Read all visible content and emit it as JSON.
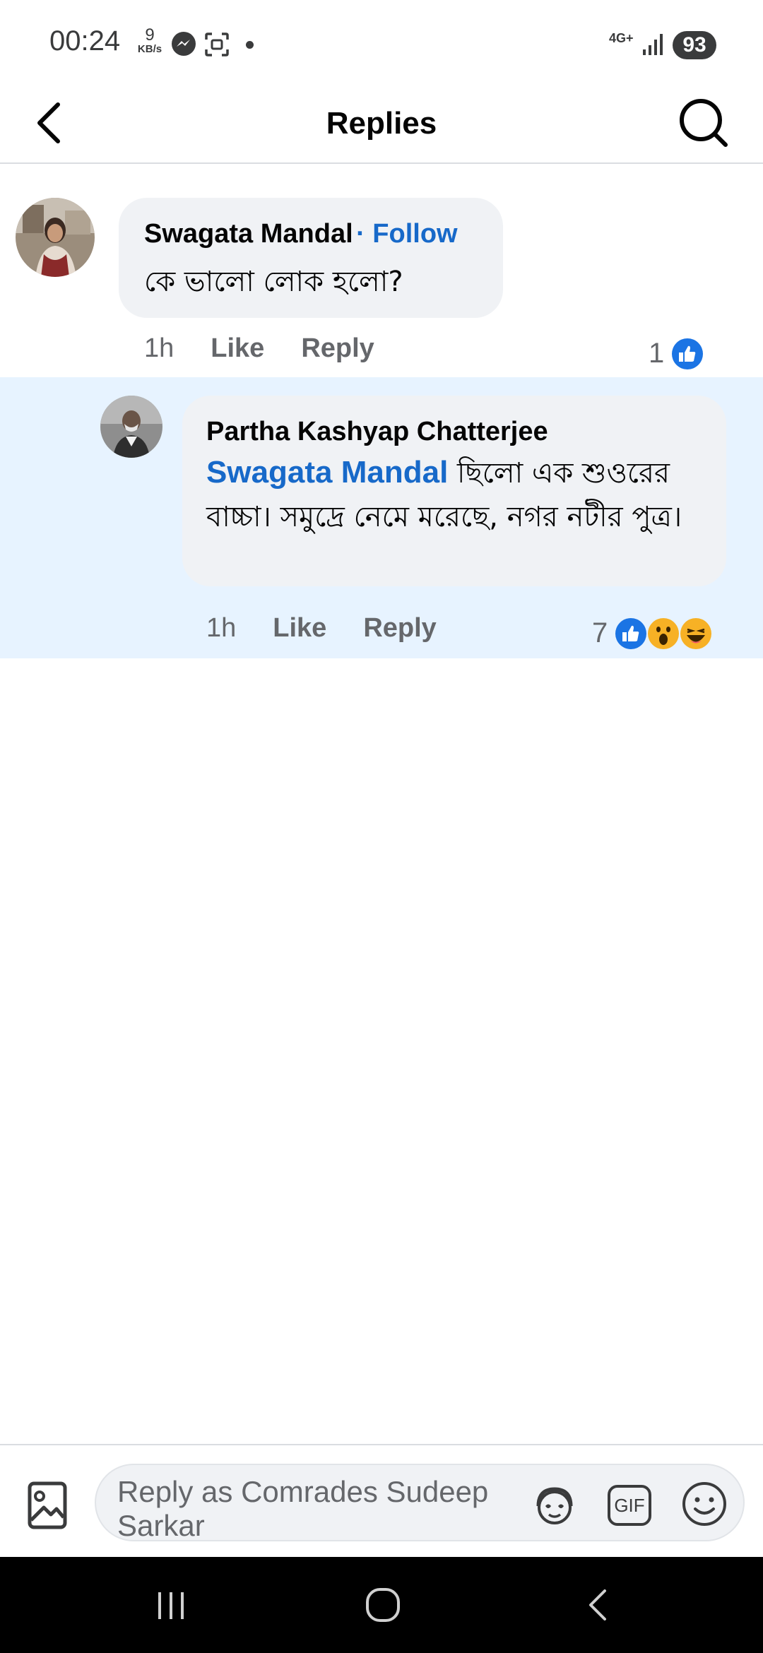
{
  "status_bar": {
    "time": "00:24",
    "data_rate": "9",
    "data_unit": "KB/s",
    "network": "4G+",
    "battery": "93"
  },
  "header": {
    "title": "Replies"
  },
  "comments": [
    {
      "author": "Swagata Mandal",
      "follow_label": "· Follow",
      "text": "কে ভালো লোক হলো?",
      "time": "1h",
      "like_label": "Like",
      "reply_label": "Reply",
      "reaction_count": "1",
      "reactions": [
        "like-icon"
      ]
    },
    {
      "author": "Partha Kashyap Chatterjee",
      "mention": "Swagata Mandal",
      "text": " ছিলো এক শুওরের বাচ্চা। সমুদ্রে নেমে মরেছে, নগর নটীর পুত্র।",
      "time": "1h",
      "like_label": "Like",
      "reply_label": "Reply",
      "reaction_count": "7",
      "reactions": [
        "like-icon",
        "wow-icon",
        "haha-icon"
      ]
    }
  ],
  "composer": {
    "placeholder": "Reply as Comrades Sudeep Sarkar",
    "gif_label": "GIF"
  },
  "colors": {
    "accent": "#1769c9",
    "highlight_bg": "#e7f3ff",
    "bubble_bg": "#f0f2f5"
  }
}
